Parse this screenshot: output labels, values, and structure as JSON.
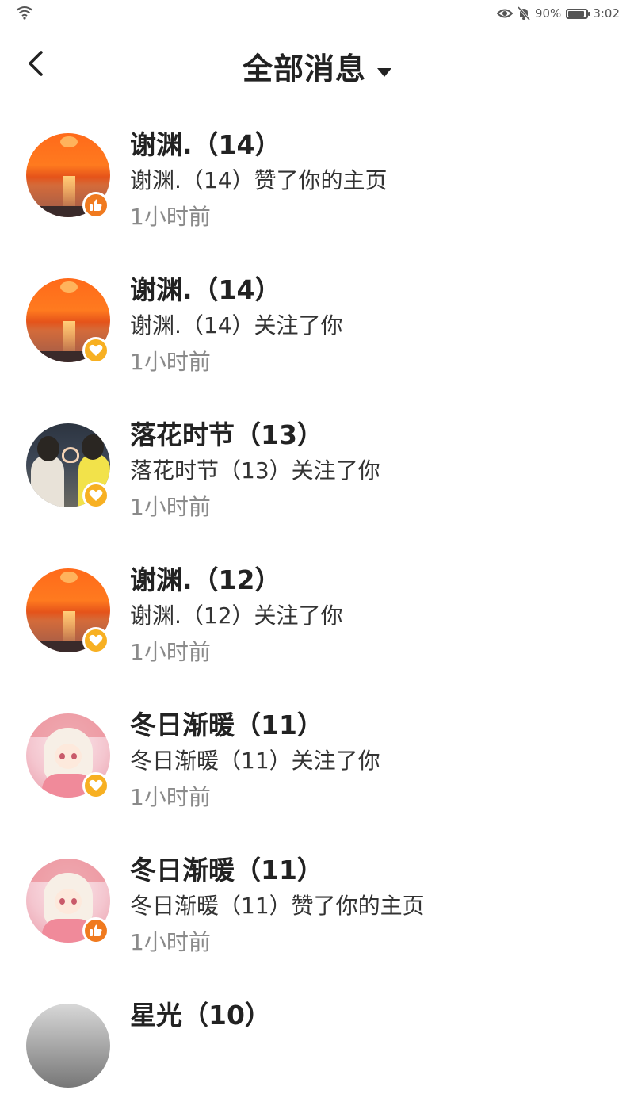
{
  "status_bar": {
    "battery_percent": "90%",
    "time": "3:02",
    "icons": [
      "wifi-icon",
      "eye-icon",
      "bell-off-icon",
      "battery-icon"
    ],
    "battery_level": 0.9
  },
  "header": {
    "title": "全部消息",
    "back_icon": "chevron-left-icon",
    "dropdown_icon": "caret-down-icon"
  },
  "colors": {
    "like_badge": "#f07a1f",
    "follow_badge": "#f7b022",
    "time_text": "#8a8a8a"
  },
  "messages": [
    {
      "name": "谢渊.（14）",
      "text": "谢渊.（14）赞了你的主页",
      "time": "1小时前",
      "type": "like",
      "avatar": "sunset-avatar"
    },
    {
      "name": "谢渊.（14）",
      "text": "谢渊.（14）关注了你",
      "time": "1小时前",
      "type": "follow",
      "avatar": "sunset-avatar"
    },
    {
      "name": "落花时节（13）",
      "text": "落花时节（13）关注了你",
      "time": "1小时前",
      "type": "follow",
      "avatar": "couple-avatar"
    },
    {
      "name": "谢渊.（12）",
      "text": "谢渊.（12）关注了你",
      "time": "1小时前",
      "type": "follow",
      "avatar": "sunset-avatar"
    },
    {
      "name": "冬日渐暖（11）",
      "text": "冬日渐暖（11）关注了你",
      "time": "1小时前",
      "type": "follow",
      "avatar": "anime-avatar"
    },
    {
      "name": "冬日渐暖（11）",
      "text": "冬日渐暖（11）赞了你的主页",
      "time": "1小时前",
      "type": "like",
      "avatar": "anime-avatar"
    },
    {
      "name": "星光（10）",
      "avatar": "dark-avatar"
    }
  ]
}
